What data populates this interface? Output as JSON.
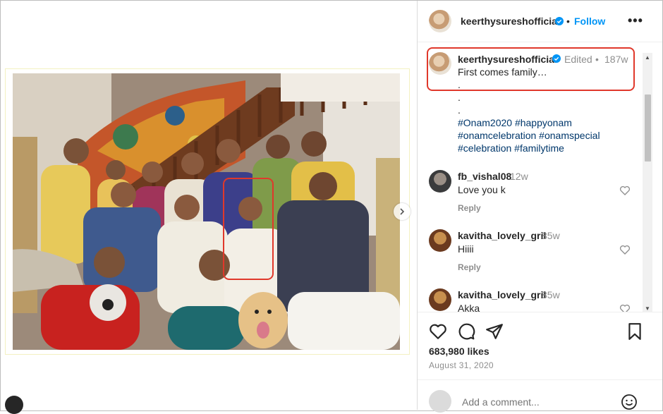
{
  "post": {
    "username": "keerthysureshofficial",
    "follow_label": "Follow",
    "more_label": "•••",
    "caption": {
      "username": "keerthysureshofficial",
      "edited": "Edited",
      "age": "187w",
      "lines": [
        "First comes family…",
        ".",
        ".",
        "."
      ],
      "hashtags": [
        "#Onam2020 #happyonam",
        "#onamcelebration #onamspecial",
        "#celebration #familytime"
      ]
    },
    "comments": [
      {
        "user": "fb_vishal08",
        "age": "12w",
        "text": "Love you k",
        "reply": "Reply"
      },
      {
        "user": "kavitha_lovely_gril",
        "age": "85w",
        "text": "Hiiii",
        "reply": "Reply"
      },
      {
        "user": "kavitha_lovely_gril",
        "age": "85w",
        "text": "Akka",
        "reply": ""
      }
    ],
    "likes": "683,980 likes",
    "date": "August 31, 2020",
    "add_comment_placeholder": "Add a comment..."
  },
  "colors": {
    "accent": "#0095f6",
    "highlight": "#e0382b",
    "hashtag": "#00376b"
  },
  "icons": [
    "verified-icon",
    "heart-icon",
    "comment-icon",
    "share-icon",
    "bookmark-icon",
    "emoji-icon",
    "chevron-right-icon"
  ]
}
